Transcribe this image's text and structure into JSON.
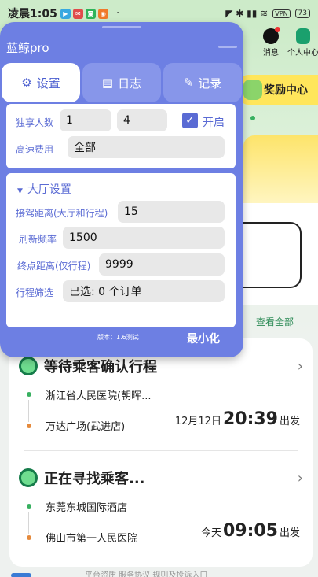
{
  "status_bar": {
    "time": "凌晨1:05",
    "dot": "·",
    "vpn": "VPN",
    "battery": "73",
    "signal_icons": "◤ ✱ ▮▮ ≋"
  },
  "background_app": {
    "message_label": "消息",
    "profile_label": "个人中心",
    "reward_label": "奖励中心",
    "view_all": "查看全部",
    "trips": [
      {
        "status": "等待乘客确认行程",
        "from": "浙江省人民医院(朝晖...",
        "to": "万达广场(武进店)",
        "date": "12月12日",
        "time": "20:39",
        "action": "出发"
      },
      {
        "status": "正在寻找乘客...",
        "from": "东莞东城国际酒店",
        "to": "佛山市第一人民医院",
        "date": "今天",
        "time": "09:05",
        "action": "出发"
      }
    ],
    "footer": "平台资质    服务协议    规则及投诉入口"
  },
  "panel": {
    "title": "蓝鲸pro",
    "tabs": [
      {
        "label": "设置",
        "icon": "gear-icon",
        "active": true
      },
      {
        "label": "日志",
        "icon": "clipboard-icon",
        "active": false
      },
      {
        "label": "记录",
        "icon": "memo-icon",
        "active": false
      }
    ],
    "exclusive": {
      "label": "独享人数",
      "min": "1",
      "max": "4",
      "toggle_label": "开启",
      "checked": true
    },
    "highway": {
      "label": "高速费用",
      "value": "全部"
    },
    "hall": {
      "title": "大厅设置",
      "pickup_distance": {
        "label": "接驾距离(大厅和行程)",
        "value": "15"
      },
      "refresh_rate": {
        "label": "刷新频率",
        "value": "1500"
      },
      "end_distance": {
        "label": "终点距离(仅行程)",
        "value": "9999"
      },
      "trip_filter": {
        "label": "行程筛选",
        "value": "已选: 0 个订单"
      }
    },
    "version": "版本：1.6测试",
    "minimize": "最小化"
  },
  "colors": {
    "panel_bg": "#6d7fe3",
    "accent": "#5a6bd4",
    "green": "#38b060",
    "orange": "#e58a3c"
  }
}
